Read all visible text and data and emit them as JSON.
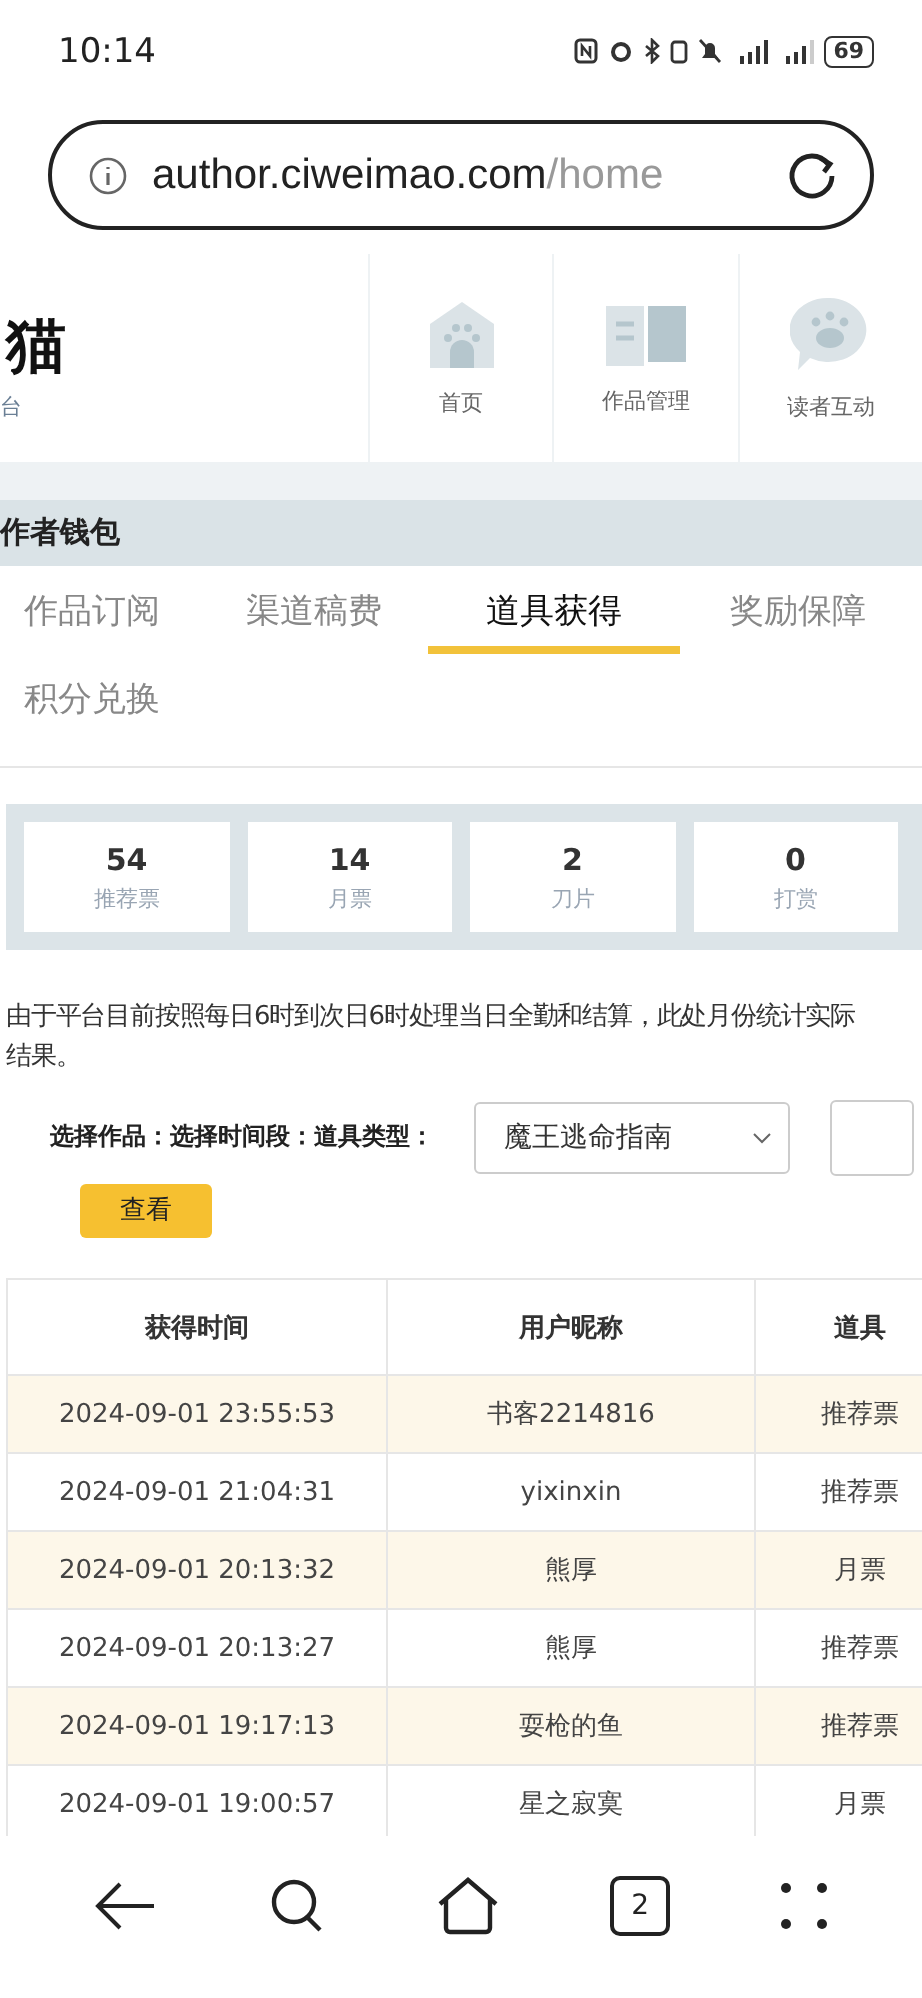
{
  "status_bar": {
    "time": "10:14",
    "battery": "69"
  },
  "address_bar": {
    "host": "author.ciweimao.com",
    "path": "/home"
  },
  "header": {
    "logo": "猫",
    "subtitle": "台",
    "nav": [
      {
        "label": "首页",
        "kind": "house"
      },
      {
        "label": "作品管理",
        "kind": "book"
      },
      {
        "label": "读者互动",
        "kind": "chat"
      }
    ]
  },
  "section_title": "作者钱包",
  "tabs": [
    {
      "label": "作品订阅",
      "selected": false
    },
    {
      "label": "渠道稿费",
      "selected": false
    },
    {
      "label": "道具获得",
      "selected": true
    },
    {
      "label": "奖励保障",
      "selected": false
    },
    {
      "label": "积分兑换",
      "selected": false
    }
  ],
  "stats": [
    {
      "value": "54",
      "label": "推荐票"
    },
    {
      "value": "14",
      "label": "月票"
    },
    {
      "value": "2",
      "label": "刀片"
    },
    {
      "value": "0",
      "label": "打赏"
    }
  ],
  "notice_lines": [
    "由于平台目前按照每日6时到次日6时处理当日全勤和结算，此处月份统计实际",
    "结果。"
  ],
  "filters": {
    "labels": "选择作品：选择时间段：道具类型：",
    "work_select": "魔王逃命指南",
    "button": "查看"
  },
  "table": {
    "columns": [
      "获得时间",
      "用户昵称",
      "道具"
    ],
    "rows": [
      [
        "2024-09-01 23:55:53",
        "书客2214816",
        "推荐票"
      ],
      [
        "2024-09-01 21:04:31",
        "yixinxin",
        "推荐票"
      ],
      [
        "2024-09-01 20:13:32",
        "熊厚",
        "月票"
      ],
      [
        "2024-09-01 20:13:27",
        "熊厚",
        "推荐票"
      ],
      [
        "2024-09-01 19:17:13",
        "耍枪的鱼",
        "推荐票"
      ],
      [
        "2024-09-01 19:00:57",
        "星之寂寞",
        "月票"
      ]
    ]
  },
  "bottom_nav": {
    "tab_count": "2"
  }
}
